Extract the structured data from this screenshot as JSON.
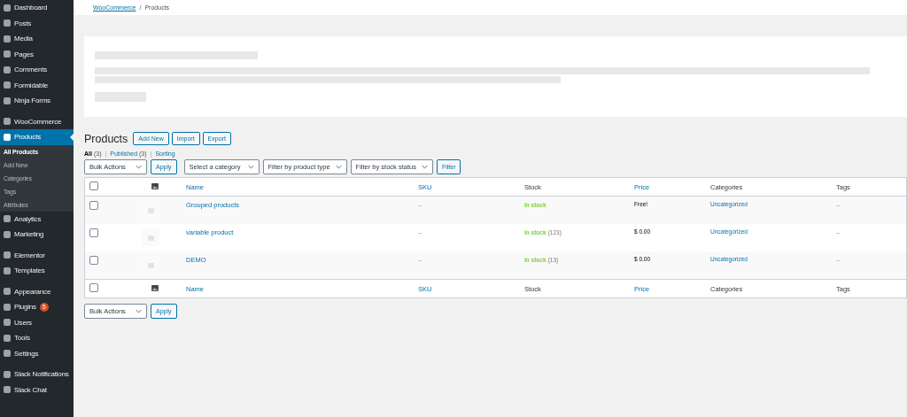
{
  "sidebar": {
    "groups": [
      {
        "items": [
          {
            "label": "Dashboard",
            "selected": false
          },
          {
            "label": "Posts",
            "selected": false
          },
          {
            "label": "Media",
            "selected": false
          },
          {
            "label": "Pages",
            "selected": false
          },
          {
            "label": "Comments",
            "selected": false
          },
          {
            "label": "Formidable",
            "selected": false
          },
          {
            "label": "Ninja Forms",
            "selected": false
          }
        ]
      },
      {
        "items": [
          {
            "label": "WooCommerce",
            "selected": false
          },
          {
            "label": "Products",
            "selected": true,
            "children": [
              {
                "label": "All Products",
                "selected": true
              },
              {
                "label": "Add New",
                "selected": false
              },
              {
                "label": "Categories",
                "selected": false
              },
              {
                "label": "Tags",
                "selected": false
              },
              {
                "label": "Attributes",
                "selected": false
              }
            ]
          },
          {
            "label": "Analytics",
            "selected": false
          },
          {
            "label": "Marketing",
            "selected": false
          }
        ]
      },
      {
        "items": [
          {
            "label": "Elementor",
            "selected": false
          },
          {
            "label": "Templates",
            "selected": false
          }
        ]
      },
      {
        "items": [
          {
            "label": "Appearance",
            "selected": false
          },
          {
            "label": "Plugins",
            "selected": false,
            "badge": "5"
          },
          {
            "label": "Users",
            "selected": false
          },
          {
            "label": "Tools",
            "selected": false
          },
          {
            "label": "Settings",
            "selected": false
          }
        ]
      },
      {
        "items": [
          {
            "label": "Slack Notifications",
            "selected": false
          },
          {
            "label": "Slack Chat",
            "selected": false
          }
        ]
      }
    ]
  },
  "breadcrumb": [
    {
      "label": "WooCommerce",
      "kind": "link"
    },
    {
      "label": "/",
      "kind": "separator"
    },
    {
      "label": "Products",
      "kind": "current"
    }
  ],
  "page_title": "Products",
  "title_buttons": [
    "Add New",
    "Import",
    "Export"
  ],
  "views": [
    {
      "label": "All",
      "count": "(3)",
      "selected": true
    },
    {
      "label": "Published",
      "count": "(3)",
      "selected": false
    },
    {
      "label": "Sorting",
      "selected": false
    }
  ],
  "view_separator": "|",
  "filters": {
    "bulk_actions": "Bulk Actions",
    "apply": "Apply",
    "selects": [
      "Select a category",
      "Filter by product type",
      "Filter by stock status"
    ],
    "filter_button": "Filter"
  },
  "table": {
    "header": {
      "checked": false,
      "columns": [
        {
          "label": "Name",
          "sortable": true
        },
        {
          "label": "SKU",
          "sortable": true
        },
        {
          "label": "Stock",
          "sortable": false
        },
        {
          "label": "Price",
          "sortable": true
        },
        {
          "label": "Categories",
          "sortable": false
        },
        {
          "label": "Tags",
          "sortable": false
        }
      ]
    },
    "footer": {
      "checked": false,
      "columns": [
        {
          "label": "Name",
          "sortable": true
        },
        {
          "label": "SKU",
          "sortable": true
        },
        {
          "label": "Stock",
          "sortable": false
        },
        {
          "label": "Price",
          "sortable": true
        },
        {
          "label": "Categories",
          "sortable": false
        },
        {
          "label": "Tags",
          "sortable": false
        }
      ]
    },
    "rows": [
      {
        "checked": false,
        "name": "Grouped products",
        "sku": "–",
        "stock": "In stock",
        "stock_count": "",
        "price": "Free!",
        "category": "Uncategorized",
        "tags": "–"
      },
      {
        "checked": false,
        "name": "variable product",
        "sku": "–",
        "stock": "In stock",
        "stock_count": "(123)",
        "price": "$ 0.00",
        "category": "Uncategorized",
        "tags": "–"
      },
      {
        "checked": false,
        "name": "DEMO",
        "sku": "–",
        "stock": "In stock",
        "stock_count": "(13)",
        "price": "$ 0.00",
        "category": "Uncategorized",
        "tags": "–"
      }
    ]
  },
  "bottom_actions": {
    "bulk_actions": "Bulk Actions",
    "apply": "Apply"
  }
}
